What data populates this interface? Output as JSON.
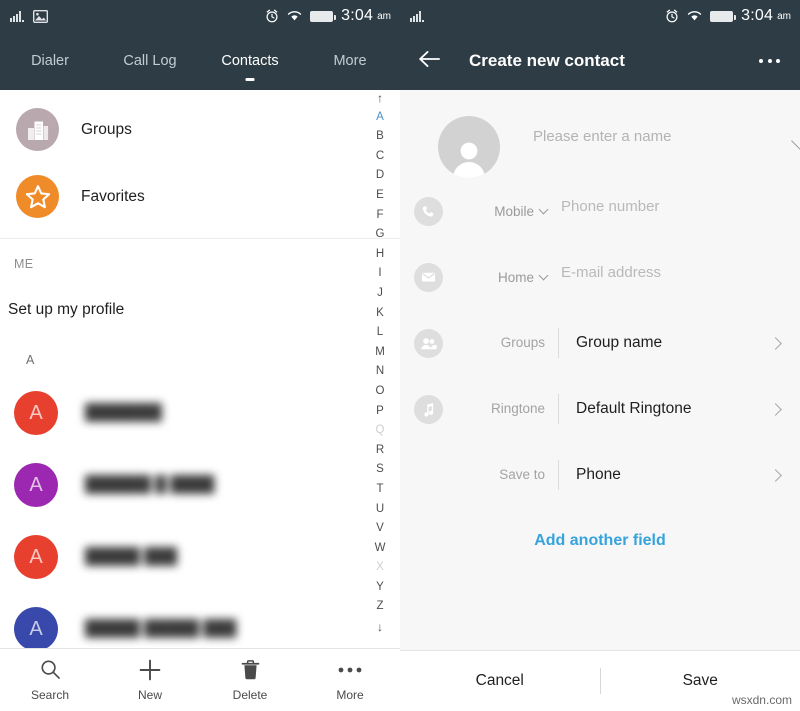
{
  "status_bar": {
    "time": "3:04",
    "ampm": "am",
    "icons": [
      "signal-icon",
      "photo-icon",
      "alarm-icon",
      "wifi-icon",
      "battery-icon"
    ]
  },
  "colors": {
    "appbar": "#2d3c45",
    "accent_link": "#36a3dd",
    "name_underline": "#3f7f93",
    "index_active": "#4a90c4",
    "favorites": "#f08b2a",
    "groups": "#b9a8ad"
  },
  "left_panel": {
    "tabs": [
      {
        "label": "Dialer",
        "active": false
      },
      {
        "label": "Call Log",
        "active": false
      },
      {
        "label": "Contacts",
        "active": true
      },
      {
        "label": "More",
        "active": false
      }
    ],
    "shortcuts": [
      {
        "label": "Groups",
        "icon": "buildings-icon"
      },
      {
        "label": "Favorites",
        "icon": "star-icon"
      }
    ],
    "me_section": {
      "header": "ME",
      "profile_label": "Set up my profile"
    },
    "list_section_header": "A",
    "contacts": [
      {
        "initial": "A",
        "color": "#e8402f",
        "name": "███████"
      },
      {
        "initial": "A",
        "color": "#9c27b0",
        "name": "██████ █ ████"
      },
      {
        "initial": "A",
        "color": "#e8402f",
        "name": "█████ ███"
      },
      {
        "initial": "A",
        "color": "#3949ab",
        "name": "█████ █████ ███"
      }
    ],
    "alpha_index": {
      "up_arrow": "↑",
      "down_arrow": "↓",
      "letters": [
        "A",
        "B",
        "C",
        "D",
        "E",
        "F",
        "G",
        "H",
        "I",
        "J",
        "K",
        "L",
        "M",
        "N",
        "O",
        "P",
        "Q",
        "R",
        "S",
        "T",
        "U",
        "V",
        "W",
        "X",
        "Y",
        "Z"
      ],
      "active": "A",
      "dimmed": [
        "Q",
        "X"
      ]
    },
    "bottom_bar": [
      {
        "label": "Search",
        "icon": "search-icon"
      },
      {
        "label": "New",
        "icon": "plus-icon"
      },
      {
        "label": "Delete",
        "icon": "trash-icon"
      },
      {
        "label": "More",
        "icon": "more-horizontal-icon"
      }
    ]
  },
  "right_panel": {
    "app_bar": {
      "back_icon": "back-arrow-icon",
      "title": "Create new contact",
      "overflow_icon": "more-horizontal-icon"
    },
    "name_field": {
      "avatar_icon": "person-placeholder-icon",
      "value": "",
      "placeholder": "Please enter a name",
      "expand_icon": "chevron-down-icon"
    },
    "fields": [
      {
        "icon": "phone-icon",
        "type_label": "Mobile",
        "value": "",
        "placeholder": "Phone number"
      },
      {
        "icon": "mail-icon",
        "type_label": "Home",
        "value": "",
        "placeholder": "E-mail address"
      }
    ],
    "pickers": [
      {
        "icon": "people-icon",
        "label": "Groups",
        "value": "Group name"
      },
      {
        "icon": "music-note-icon",
        "label": "Ringtone",
        "value": "Default Ringtone"
      },
      {
        "icon": "",
        "label": "Save to",
        "value": "Phone"
      }
    ],
    "add_field_label": "Add another field",
    "footer": {
      "cancel_label": "Cancel",
      "save_label": "Save"
    }
  },
  "watermark": "wsxdn.com"
}
